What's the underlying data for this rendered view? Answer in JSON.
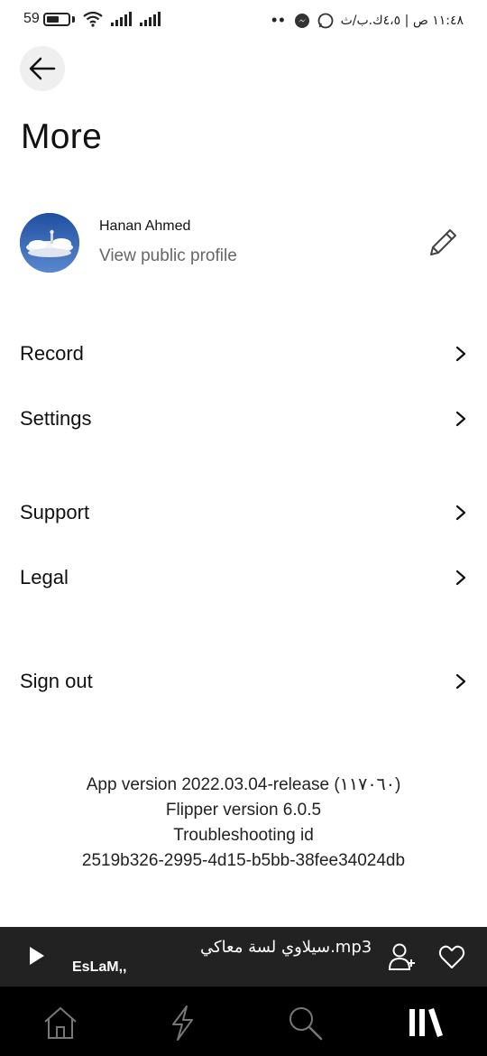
{
  "status_bar": {
    "battery_level": "59",
    "time_text": "١١:٤٨ ص | ٤،٥ك.ب/ث",
    "battery_fraction": 0.59
  },
  "page": {
    "title": "More"
  },
  "profile": {
    "name": "Hanan Ahmed",
    "link_label": "View public profile"
  },
  "menu": {
    "items": [
      {
        "label": "Record"
      },
      {
        "label": "Settings"
      },
      {
        "label": "Support"
      },
      {
        "label": "Legal"
      },
      {
        "label": "Sign out"
      }
    ]
  },
  "version_info": {
    "app_version": "App version 2022.03.04-release (١١٧٠٦٠)",
    "flipper_version": "Flipper version 6.0.5",
    "troubleshooting_label": "Troubleshooting id",
    "troubleshooting_id": "2519b326-2995-4d15-b5bb-38fee34024db"
  },
  "player": {
    "track_title": "سيلاوي لسة معاكي.mp3",
    "artist": "EsLaM,,"
  },
  "tabbar": {
    "tabs": [
      {
        "icon": "home-icon"
      },
      {
        "icon": "lightning-icon"
      },
      {
        "icon": "search-icon"
      },
      {
        "icon": "library-icon",
        "active": true
      }
    ]
  },
  "colors": {
    "player_background": "#222222",
    "tabbar_background": "#000000",
    "secondary_text": "#666666"
  }
}
